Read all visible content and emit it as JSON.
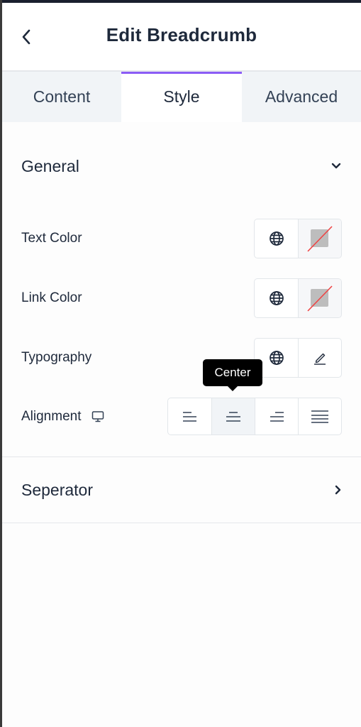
{
  "header": {
    "title": "Edit Breadcrumb",
    "back_icon": "chevron-left-icon"
  },
  "tabs": [
    {
      "label": "Content",
      "active": false
    },
    {
      "label": "Style",
      "active": true
    },
    {
      "label": "Advanced",
      "active": false
    }
  ],
  "accent_color": "#8b5cf6",
  "sections": {
    "general": {
      "label": "General",
      "expanded": true,
      "toggle_icon": "chevron-down-icon",
      "controls": [
        {
          "label": "Text Color",
          "icons": [
            "globe-icon",
            "no-color-swatch-icon"
          ]
        },
        {
          "label": "Link Color",
          "icons": [
            "globe-icon",
            "no-color-swatch-icon"
          ]
        },
        {
          "label": "Typography",
          "icons": [
            "globe-icon",
            "pencil-icon"
          ]
        },
        {
          "label": "Alignment",
          "device_icon": "desktop-icon",
          "options": [
            {
              "name": "Left",
              "icon": "align-left-icon"
            },
            {
              "name": "Center",
              "icon": "align-center-icon",
              "selected": true
            },
            {
              "name": "Right",
              "icon": "align-right-icon"
            },
            {
              "name": "Justify",
              "icon": "align-justify-icon"
            }
          ],
          "tooltip": "Center"
        }
      ]
    },
    "separator": {
      "label": "Seperator",
      "expanded": false,
      "toggle_icon": "chevron-right-icon"
    }
  }
}
